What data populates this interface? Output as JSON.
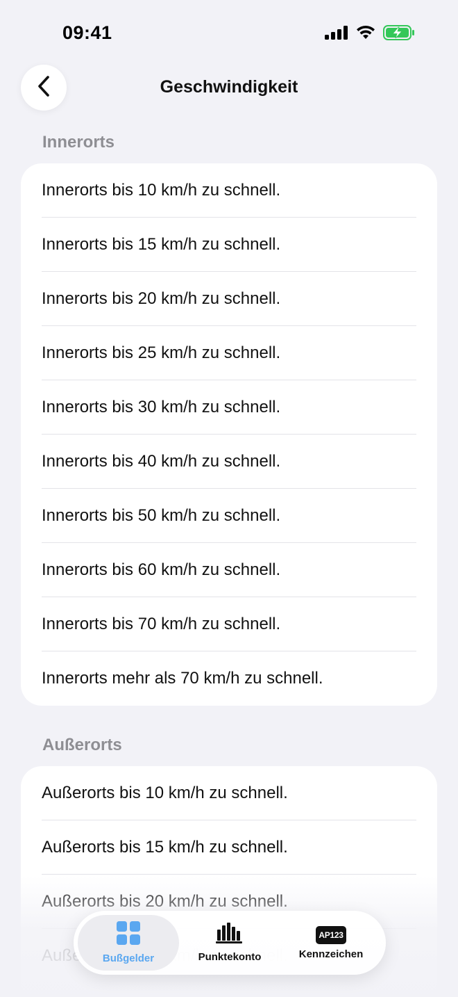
{
  "status_bar": {
    "time": "09:41",
    "icons": [
      "cellular-signal-icon",
      "wifi-icon",
      "battery-charging-icon"
    ],
    "battery_color": "#34c759"
  },
  "header": {
    "title": "Geschwindigkeit",
    "back_icon": "chevron-left-icon"
  },
  "sections": [
    {
      "title": "Innerorts",
      "items": [
        "Innerorts bis 10 km/h zu schnell.",
        "Innerorts bis 15 km/h zu schnell.",
        "Innerorts bis 20 km/h zu schnell.",
        "Innerorts bis 25 km/h zu schnell.",
        "Innerorts bis 30 km/h zu schnell.",
        "Innerorts bis 40 km/h zu schnell.",
        "Innerorts bis 50 km/h zu schnell.",
        "Innerorts bis 60 km/h zu schnell.",
        "Innerorts bis 70 km/h zu schnell.",
        "Innerorts mehr als 70 km/h zu schnell."
      ]
    },
    {
      "title": "Außerorts",
      "items": [
        "Außerorts bis 10 km/h zu schnell.",
        "Außerorts bis 15 km/h zu schnell.",
        "Außerorts bis 20 km/h zu schnell.",
        "Außerorts bis 25 km/h zu schnell."
      ]
    }
  ],
  "tab_bar": {
    "tabs": [
      {
        "label": "Bußgelder",
        "icon": "grid-icon",
        "active": true
      },
      {
        "label": "Punktekonto",
        "icon": "bar-chart-icon",
        "active": false
      },
      {
        "label": "Kennzeichen",
        "icon": "license-plate-icon",
        "plate_text": "AP123",
        "active": false
      }
    ],
    "active_color": "#5aa7f0"
  }
}
